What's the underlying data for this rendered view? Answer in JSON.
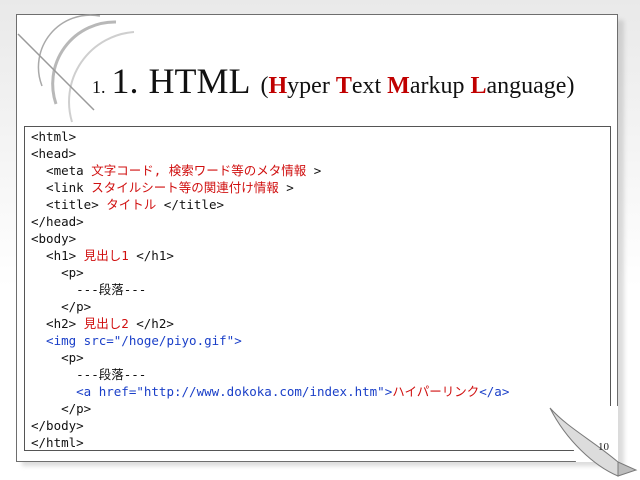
{
  "slide": {
    "title": {
      "num_small": "1.",
      "num_big": "1.",
      "main": "HTML",
      "paren_open": "(",
      "h_cap": "H",
      "h_rest": "yper ",
      "t_cap": "T",
      "t_rest": "ext ",
      "m_cap": "M",
      "m_rest": "arkup ",
      "l_cap": "L",
      "l_rest": "anguage",
      "paren_close": ")"
    },
    "page_number": "10",
    "code": {
      "l1": "<html>",
      "l2": "<head>",
      "l3_tag": "  <meta ",
      "l3_text": "文字コード, 検索ワード等のメタ情報",
      "l3_end": " >",
      "l4_tag": "  <link ",
      "l4_text": "スタイルシート等の関連付け情報",
      "l4_end": " >",
      "l5_tag": "  <title> ",
      "l5_text": "タイトル",
      "l5_end": " </title>",
      "l6": "</head>",
      "l7": "<body>",
      "l8_tag": "  <h1> ",
      "l8_text": "見出し1",
      "l8_end": " </h1>",
      "l9": "    <p>",
      "l10": "      ---段落---",
      "l11": "    </p>",
      "l12_tag": "  <h2> ",
      "l12_text": "見出し2",
      "l12_end": " </h2>",
      "l13": "  <img src=\"/hoge/piyo.gif\">",
      "l14": "    <p>",
      "l15": "      ---段落---",
      "l16_a": "      <a href=\"http://www.dokoka.com/index.htm\">",
      "l16_text": "ハイパーリンク",
      "l16_end": "</a>",
      "l17": "    </p>",
      "l18": "</body>",
      "l19": "</html>"
    }
  }
}
